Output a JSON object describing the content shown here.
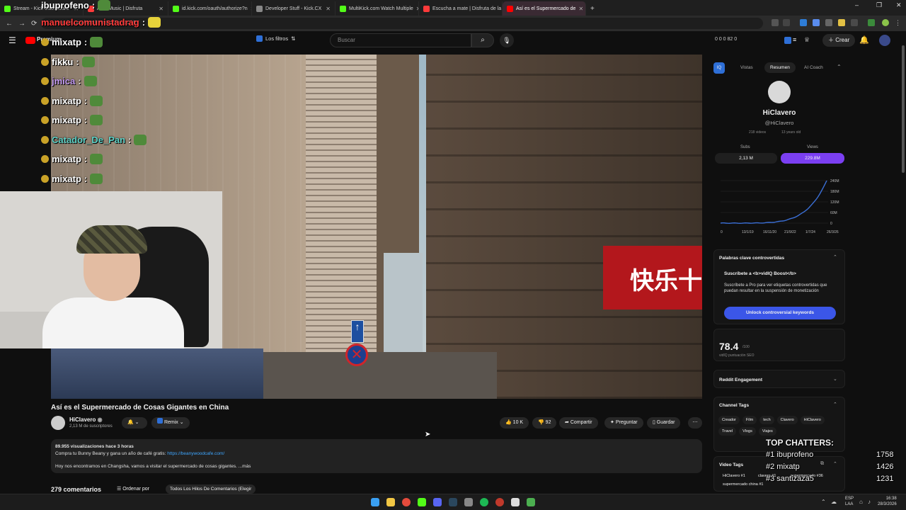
{
  "browser": {
    "tabs": [
      {
        "label": "Stream - Kick Dashboard",
        "color": "#53fc18"
      },
      {
        "label": "ADP Music | Disfruta",
        "color": "#ff3a3a"
      },
      {
        "label": "id.kick.com/oauth/authorize?n",
        "color": "#53fc18"
      },
      {
        "label": "Developer Stuff - Kick.CX",
        "color": "#888888"
      },
      {
        "label": "MultiKick.com Watch Multiple",
        "color": "#53fc18"
      },
      {
        "label": "Escucha a mate | Disfruta de la",
        "color": "#ff3a3a"
      },
      {
        "label": "Así es el Supermercado de",
        "color": "#ff0000",
        "active": true
      }
    ],
    "url": "youtube.com/watch?v=3rQ5wN5CbE5",
    "new_tab": "+"
  },
  "overlay_chat": [
    {
      "user": "ibuprofeno",
      "suffix": ":",
      "color": "#ffffff",
      "top": "alert"
    },
    {
      "user": "manuelcomunistadrag",
      "suffix": ":",
      "color": "#ff3b3b"
    },
    {
      "user": "mixatp",
      "suffix": ":",
      "color": "#ffffff"
    },
    {
      "user": "fikku",
      "suffix": ":",
      "color": "#ffffff"
    },
    {
      "user": "jmica",
      "suffix": ":",
      "color": "#c79df5"
    },
    {
      "user": "mixatp",
      "suffix": ":",
      "color": "#ffffff"
    },
    {
      "user": "mixatp",
      "suffix": ":",
      "color": "#ffffff"
    },
    {
      "user": "Catador_De_Pan",
      "suffix": ":",
      "color": "#5fd3c8"
    },
    {
      "user": "mixatp",
      "suffix": ":",
      "color": "#ffffff"
    },
    {
      "user": "mixatp",
      "suffix": ":",
      "color": "#ffffff"
    }
  ],
  "youtube": {
    "logo": "Premium",
    "filters_label": "Los filtros",
    "search_placeholder": "Buscar",
    "counters": "0  0  0  82  0",
    "create_label": "Crear"
  },
  "video": {
    "title": "Así es el Supermercado de Cosas Gigantes en China",
    "sign_text": "快乐十"
  },
  "channel": {
    "name": "HiClavero",
    "subs": "2,13 M de suscriptores"
  },
  "actions": {
    "remix": "Remix",
    "likes": "10 K",
    "dislikes": "92",
    "share": "Compartir",
    "ask": "Preguntar",
    "save": "Guardar"
  },
  "description": {
    "meta": "89.955 visualizaciones  hace 3 horas",
    "line1": "Compra tu Bunny Beany y gana un año de café gratis: ",
    "link": "https://beanywoodcafe.com/",
    "line2": "Hoy nos encontramos en Changsha, vamos a visitar el supermercado de cosas gigantes. ...más"
  },
  "comments": {
    "count": "279 comentarios",
    "sort": "Ordenar por",
    "all": "Todos Los Hilos De Comentarios (Elegir"
  },
  "vidiq": {
    "tabs": [
      "Vistas",
      "Resumen",
      "AI Coach"
    ],
    "channel_name": "HiClavero",
    "handle": "@HiClavero",
    "videos": "218 videos",
    "age": "13 years old",
    "subs_label": "Subs",
    "subs_value": "2,13 M",
    "views_label": "Views",
    "views_value": "229.8M",
    "chart_ylabels": [
      "240M",
      "180M",
      "120M",
      "60M",
      "0"
    ],
    "chart_xlabels": [
      "0",
      "13/1/19",
      "16/11/20",
      "21/9/22",
      "1/7/24",
      "26/3/26"
    ],
    "kw_title": "Palabras clave controvertidas",
    "kw_pro": "Suscríbete a <b>vidIQ Boost</b>",
    "kw_text": "Suscríbete a Pro para ver etiquetas controvertidas que puedan resultar en la suspensión de monetización",
    "kw_button": "Unlock controversial keywords",
    "seo_score": "78.4",
    "seo_out": "/100",
    "seo_label": "vidIQ puntuación SEO",
    "reddit": "Reddit Engagement",
    "tags_title": "Channel Tags",
    "tags": [
      "Creador",
      "Film",
      "tech",
      "Clavero",
      "HiClavero",
      "Travel",
      "Vlogs",
      "Viajes"
    ],
    "video_tags": "Video Tags",
    "vt_items": [
      "HiClavero #1",
      "clavero #1",
      "supermercado #36",
      "supermercado china #1"
    ]
  },
  "top_chatters": {
    "title": "TOP CHATTERS:",
    "rows": [
      {
        "name": "#1 ibuprofeno",
        "count": "1758"
      },
      {
        "name": "#2 mixatp",
        "count": "1426"
      },
      {
        "name": "#3 santizaza5",
        "count": "1231"
      }
    ]
  },
  "taskbar": {
    "lang": "ESP",
    "layout": "LAA",
    "time": "16:38",
    "date": "28/3/2026"
  }
}
